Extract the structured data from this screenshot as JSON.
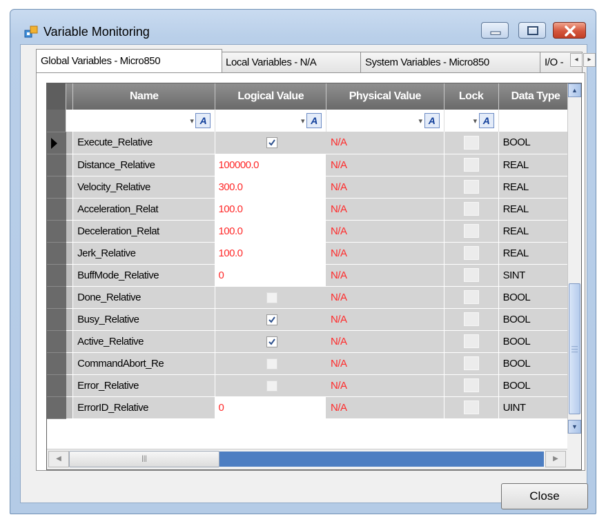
{
  "window": {
    "title": "Variable Monitoring"
  },
  "tabs": [
    {
      "label": "Global Variables - Micro850",
      "active": true
    },
    {
      "label": "Local Variables - N/A",
      "active": false
    },
    {
      "label": "System Variables - Micro850",
      "active": false
    },
    {
      "label": "I/O -",
      "active": false
    }
  ],
  "grid": {
    "columns": [
      "Name",
      "Logical Value",
      "Physical Value",
      "Lock",
      "Data Type"
    ],
    "filter_icon": "A",
    "rows": [
      {
        "name": "Execute_Relative",
        "logical": "",
        "logical_checkbox": "checked",
        "physical": "N/A",
        "data_type": "BOOL",
        "current": true
      },
      {
        "name": "Distance_Relative",
        "logical": "100000.0",
        "physical": "N/A",
        "data_type": "REAL"
      },
      {
        "name": "Velocity_Relative",
        "logical": "300.0",
        "physical": "N/A",
        "data_type": "REAL"
      },
      {
        "name": "Acceleration_Relat",
        "logical": "100.0",
        "physical": "N/A",
        "data_type": "REAL"
      },
      {
        "name": "Deceleration_Relat",
        "logical": "100.0",
        "physical": "N/A",
        "data_type": "REAL"
      },
      {
        "name": "Jerk_Relative",
        "logical": "100.0",
        "physical": "N/A",
        "data_type": "REAL"
      },
      {
        "name": "BuffMode_Relative",
        "logical": "0",
        "physical": "N/A",
        "data_type": "SINT"
      },
      {
        "name": "Done_Relative",
        "logical": "",
        "logical_checkbox": "unchecked",
        "physical": "N/A",
        "data_type": "BOOL"
      },
      {
        "name": "Busy_Relative",
        "logical": "",
        "logical_checkbox": "checked",
        "physical": "N/A",
        "data_type": "BOOL"
      },
      {
        "name": "Active_Relative",
        "logical": "",
        "logical_checkbox": "checked",
        "physical": "N/A",
        "data_type": "BOOL"
      },
      {
        "name": "CommandAbort_Re",
        "logical": "",
        "logical_checkbox": "unchecked",
        "physical": "N/A",
        "data_type": "BOOL"
      },
      {
        "name": "Error_Relative",
        "logical": "",
        "logical_checkbox": "unchecked",
        "physical": "N/A",
        "data_type": "BOOL"
      },
      {
        "name": "ErrorID_Relative",
        "logical": "0",
        "physical": "N/A",
        "data_type": "UINT"
      }
    ]
  },
  "buttons": {
    "close": "Close"
  },
  "colors": {
    "value_text": "#ff2a2a",
    "header_bg": "#6a6a6a",
    "cell_bg": "#d4d4d4",
    "scroll_accent": "#4d7ec2"
  },
  "icons": [
    "app-icon",
    "minimize-icon",
    "maximize-icon",
    "close-icon",
    "row-indicator-arrow-icon",
    "filter-icon",
    "checkbox-icon",
    "scroll-up-icon",
    "scroll-down-icon",
    "scroll-left-icon",
    "scroll-right-icon",
    "tab-scroll-left-icon",
    "tab-scroll-right-icon"
  ]
}
